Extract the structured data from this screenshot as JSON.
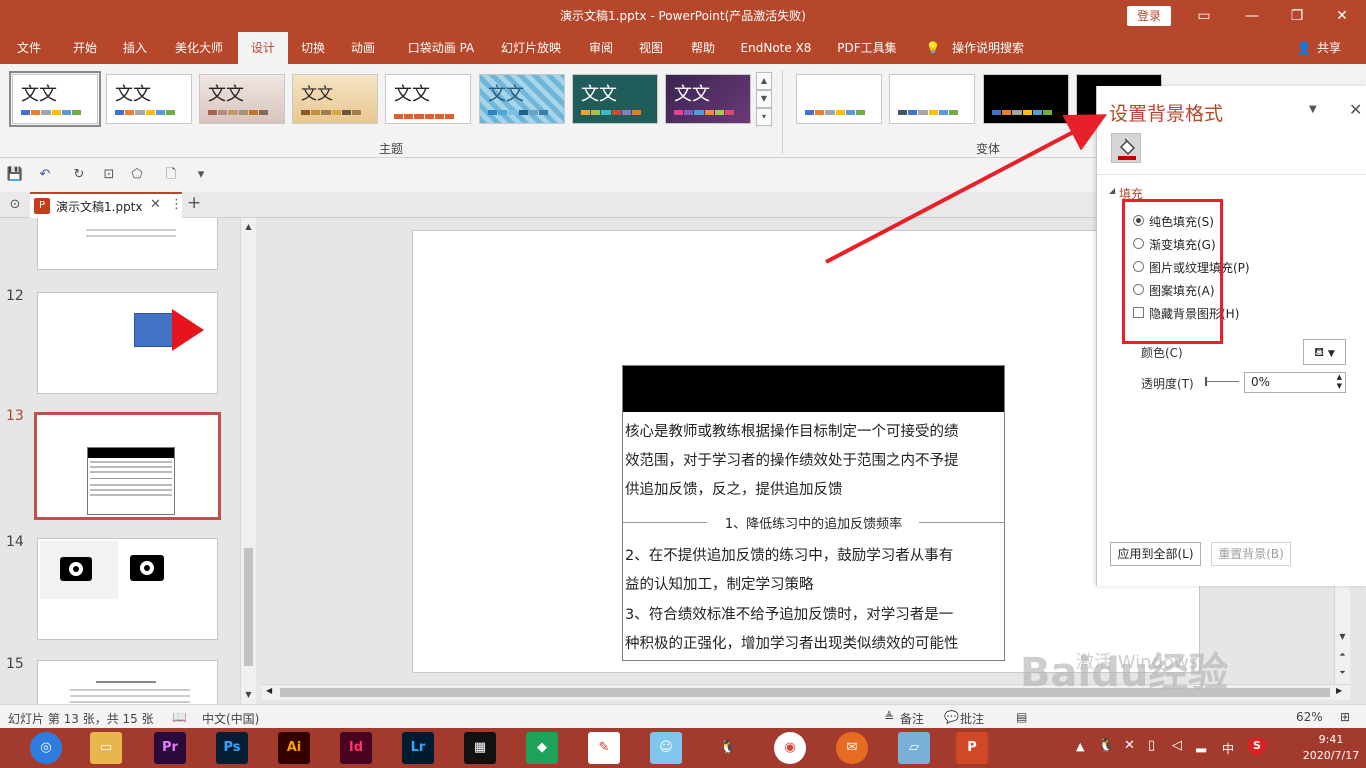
{
  "window": {
    "title": "演示文稿1.pptx  -  PowerPoint(产品激活失败)",
    "login": "登录"
  },
  "ribbon_tabs": [
    "文件",
    "开始",
    "插入",
    "美化大师",
    "设计",
    "切换",
    "动画",
    "口袋动画 PA",
    "幻灯片放映",
    "审阅",
    "视图",
    "帮助",
    "EndNote X8",
    "PDF工具集",
    "操作说明搜索"
  ],
  "share": "共享",
  "ribbon": {
    "theme_word": "文文",
    "group_themes": "主题",
    "group_variants": "变体"
  },
  "doc_tab": {
    "name": "演示文稿1.pptx",
    "pp_letter": "P"
  },
  "thumbnails": {
    "numbers": [
      "12",
      "13",
      "14",
      "15"
    ]
  },
  "slide": {
    "para1": [
      "核心是教师或教练根据操作目标制定一个可接受的绩",
      "效范围，对于学习者的操作绩效处于范围之内不予提",
      "供追加反馈，反之，提供追加反馈"
    ],
    "center_label": "1、降低练习中的追加反馈频率",
    "para2": [
      "2、在不提供追加反馈的练习中，鼓励学习者从事有",
      "益的认知加工，制定学习策略",
      "3、符合绩效标准不给予追加反馈时，对学习者是一",
      "种积极的正强化，增加学习者出现类似绩效的可能性"
    ]
  },
  "pane": {
    "title": "设置背景格式",
    "section": "填充",
    "options": [
      "纯色填充(S)",
      "渐变填充(G)",
      "图片或纹理填充(P)",
      "图案填充(A)"
    ],
    "hide_bg": "隐藏背景图形(H)",
    "color_label": "颜色(C)",
    "transparency_label": "透明度(T)",
    "transparency_value": "0%",
    "apply_all": "应用到全部(L)",
    "reset": "重置背景(B)"
  },
  "status": {
    "slide_info": "幻灯片 第 13 张，共 15 张",
    "language": "中文(中国)",
    "notes": "备注",
    "comments": "批注",
    "zoom": "62%"
  },
  "taskbar": {
    "apps": [
      "Pr",
      "Ps",
      "Ai",
      "Id",
      "Lr"
    ],
    "ime": "中",
    "time": "9:41",
    "date": "2020/7/17"
  },
  "colors": {
    "brand": "#b7472a",
    "highlight": "#e8202a"
  }
}
